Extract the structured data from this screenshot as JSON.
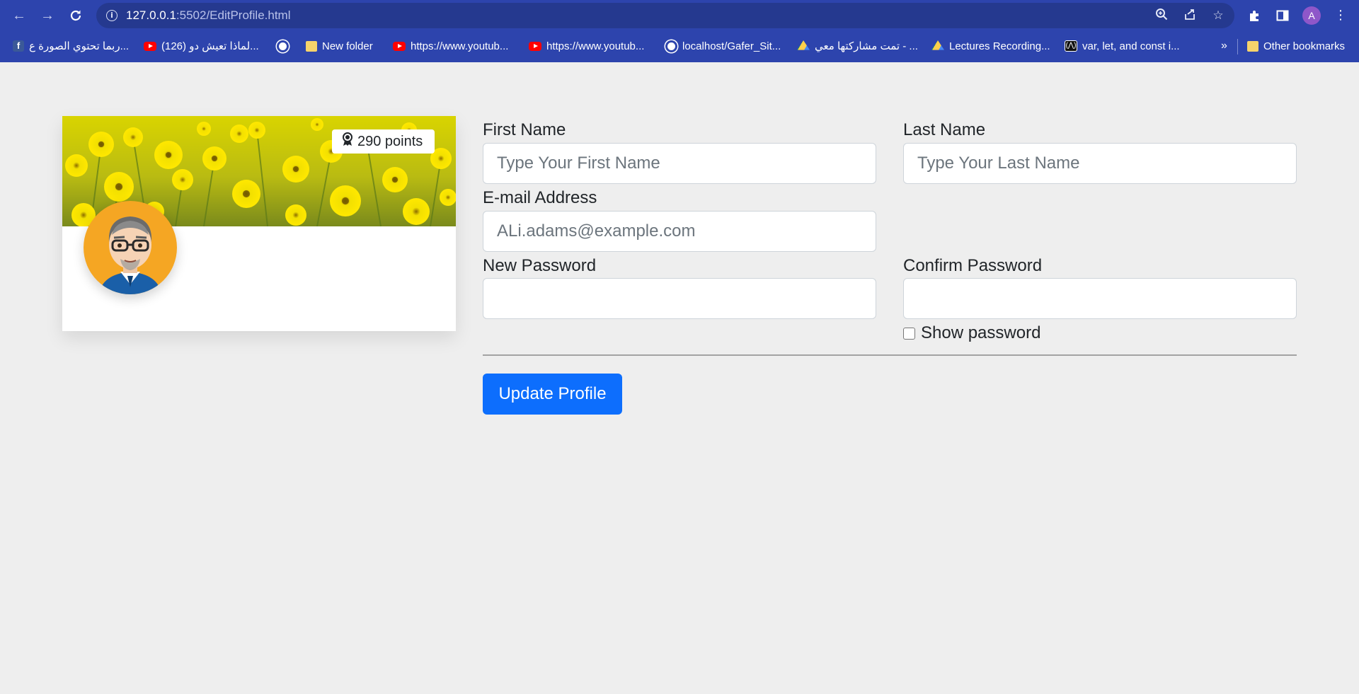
{
  "browser": {
    "url_host": "127.0.0.1",
    "url_path": ":5502/EditProfile.html",
    "profile_initial": "A",
    "bookmarks": [
      {
        "label": "ربما تحتوي الصورة ع...",
        "icon": "facebook-icon"
      },
      {
        "label": "(126) لماذا تعيش دو...",
        "icon": "youtube-icon"
      },
      {
        "label": "",
        "icon": "globe-icon"
      },
      {
        "label": "New folder",
        "icon": "folder-icon"
      },
      {
        "label": "https://www.youtub...",
        "icon": "youtube-icon"
      },
      {
        "label": "https://www.youtub...",
        "icon": "youtube-icon"
      },
      {
        "label": "localhost/Gafer_Sit...",
        "icon": "globe-icon"
      },
      {
        "label": "تمت مشاركتها معي - ...",
        "icon": "google-drive-icon"
      },
      {
        "label": "Lectures Recording...",
        "icon": "google-drive-icon"
      },
      {
        "label": "var, let, and const i...",
        "icon": "site-icon"
      }
    ],
    "more_bookmarks": "»",
    "other_bookmarks": "Other bookmarks"
  },
  "profile_card": {
    "points": "290 points"
  },
  "form": {
    "first_name_label": "First Name",
    "first_name_placeholder": "Type Your First Name",
    "last_name_label": "Last Name",
    "last_name_placeholder": "Type Your Last Name",
    "email_label": "E-mail Address",
    "email_placeholder": "ALi.adams@example.com",
    "new_password_label": "New Password",
    "confirm_password_label": "Confirm Password",
    "show_password_label": "Show password",
    "show_password_checked": false,
    "submit_label": "Update Profile"
  },
  "colors": {
    "browser_frame": "#2d44ad",
    "page_background": "#eeeeee",
    "primary_button": "#0d6efd"
  }
}
